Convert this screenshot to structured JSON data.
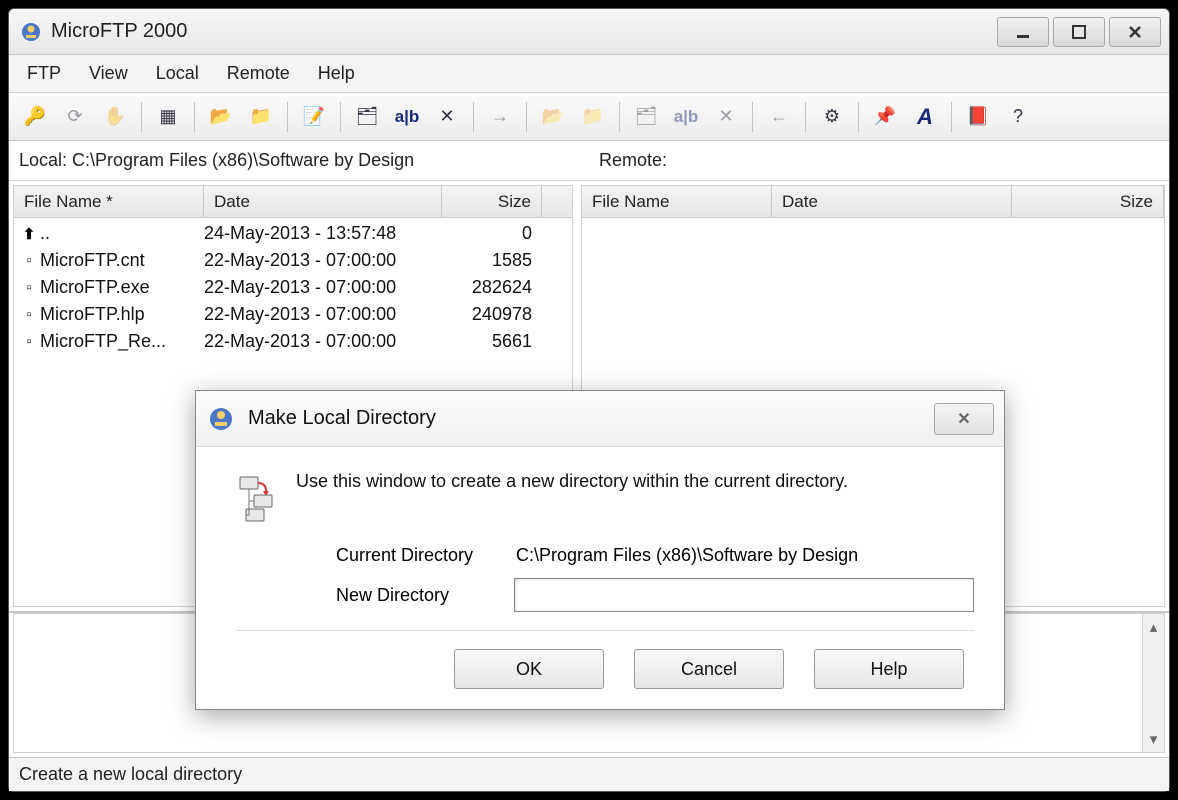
{
  "app": {
    "title": "MicroFTP 2000"
  },
  "menu": {
    "items": [
      "FTP",
      "View",
      "Local",
      "Remote",
      "Help"
    ]
  },
  "toolbar": {
    "buttons": [
      {
        "name": "connect-icon",
        "glyph": "🔑",
        "enabled": true
      },
      {
        "name": "refresh-icon",
        "glyph": "⟳",
        "enabled": false
      },
      {
        "name": "abort-icon",
        "glyph": "✋",
        "enabled": false
      },
      {
        "sep": true
      },
      {
        "name": "transfer-mode-icon",
        "glyph": "▦",
        "enabled": true
      },
      {
        "sep": true
      },
      {
        "name": "local-open-icon",
        "glyph": "📂",
        "enabled": true
      },
      {
        "name": "local-up-icon",
        "glyph": "📁",
        "enabled": true
      },
      {
        "sep": true
      },
      {
        "name": "local-edit-icon",
        "glyph": "📝",
        "enabled": true
      },
      {
        "sep": true
      },
      {
        "name": "local-mkdir-icon",
        "glyph": "🗂",
        "enabled": true
      },
      {
        "name": "local-rename-icon",
        "glyph": "a|b",
        "enabled": true,
        "text": true
      },
      {
        "name": "local-delete-icon",
        "glyph": "✕",
        "enabled": true
      },
      {
        "sep": true
      },
      {
        "name": "upload-icon",
        "glyph": "→",
        "enabled": false
      },
      {
        "sep": true
      },
      {
        "name": "remote-open-icon",
        "glyph": "📂",
        "enabled": false
      },
      {
        "name": "remote-up-icon",
        "glyph": "📁",
        "enabled": false
      },
      {
        "sep": true
      },
      {
        "name": "remote-mkdir-icon",
        "glyph": "🗂",
        "enabled": false
      },
      {
        "name": "remote-rename-icon",
        "glyph": "a|b",
        "enabled": false,
        "text": true
      },
      {
        "name": "remote-delete-icon",
        "glyph": "✕",
        "enabled": false
      },
      {
        "sep": true
      },
      {
        "name": "download-icon",
        "glyph": "←",
        "enabled": false
      },
      {
        "sep": true
      },
      {
        "name": "auto-icon",
        "glyph": "⚙",
        "enabled": true
      },
      {
        "sep": true
      },
      {
        "name": "pin-icon",
        "glyph": "📌",
        "enabled": true
      },
      {
        "name": "font-icon",
        "glyph": "A",
        "enabled": true,
        "italic": true
      },
      {
        "sep": true
      },
      {
        "name": "help-book-icon",
        "glyph": "📕",
        "enabled": true
      },
      {
        "name": "help-icon",
        "glyph": "?",
        "enabled": true
      }
    ]
  },
  "paths": {
    "local_label": "Local: C:\\Program Files (x86)\\Software by Design",
    "remote_label": "Remote:"
  },
  "local": {
    "columns": {
      "name": "File Name *",
      "date": "Date",
      "size": "Size"
    },
    "rows": [
      {
        "icon": "up",
        "name": "..",
        "date": "24-May-2013 - 13:57:48",
        "size": "0"
      },
      {
        "icon": "file",
        "name": "MicroFTP.cnt",
        "date": "22-May-2013 - 07:00:00",
        "size": "1585"
      },
      {
        "icon": "file",
        "name": "MicroFTP.exe",
        "date": "22-May-2013 - 07:00:00",
        "size": "282624"
      },
      {
        "icon": "file",
        "name": "MicroFTP.hlp",
        "date": "22-May-2013 - 07:00:00",
        "size": "240978"
      },
      {
        "icon": "file",
        "name": "MicroFTP_Re...",
        "date": "22-May-2013 - 07:00:00",
        "size": "5661"
      }
    ]
  },
  "remote": {
    "columns": {
      "name": "File Name",
      "date": "Date",
      "size": "Size"
    },
    "rows": []
  },
  "statusbar": {
    "text": "Create a new local directory"
  },
  "dialog": {
    "title": "Make Local Directory",
    "instruction": "Use this window to create a new directory within the current directory.",
    "current_dir_label": "Current Directory",
    "current_dir_value": "C:\\Program Files (x86)\\Software by Design",
    "new_dir_label": "New Directory",
    "new_dir_value": "",
    "buttons": {
      "ok": "OK",
      "cancel": "Cancel",
      "help": "Help"
    }
  }
}
